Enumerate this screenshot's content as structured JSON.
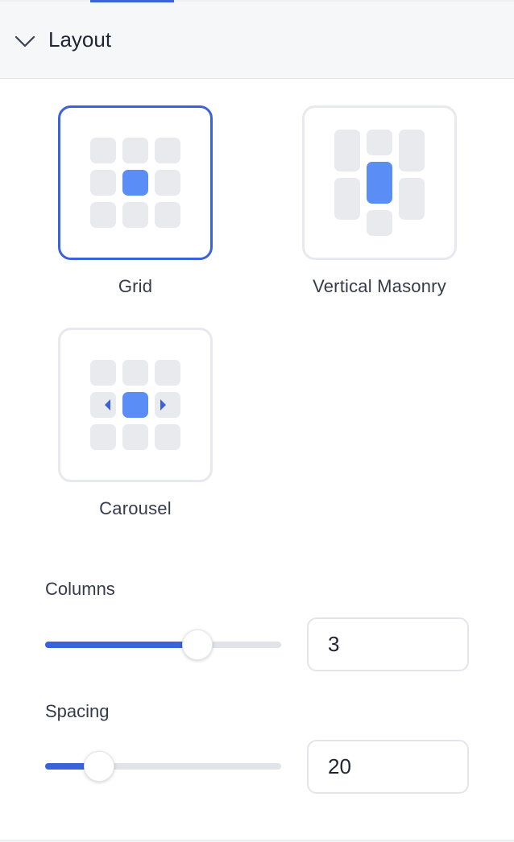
{
  "section": {
    "title": "Layout",
    "expanded": true
  },
  "layouts": [
    {
      "id": "grid",
      "label": "Grid",
      "selected": true,
      "icon": "grid-layout-icon"
    },
    {
      "id": "vertical-masonry",
      "label": "Vertical Masonry",
      "selected": false,
      "icon": "masonry-layout-icon"
    },
    {
      "id": "carousel",
      "label": "Carousel",
      "selected": false,
      "icon": "carousel-layout-icon"
    }
  ],
  "columns": {
    "label": "Columns",
    "value": "3",
    "slider_fraction": 0.645
  },
  "spacing": {
    "label": "Spacing",
    "value": "20",
    "slider_fraction": 0.23
  },
  "colors": {
    "accent": "#3b63d9",
    "tile_active": "#5b8df6",
    "tile_inactive": "#e9eaee",
    "border_inactive": "#e8e9ee"
  }
}
